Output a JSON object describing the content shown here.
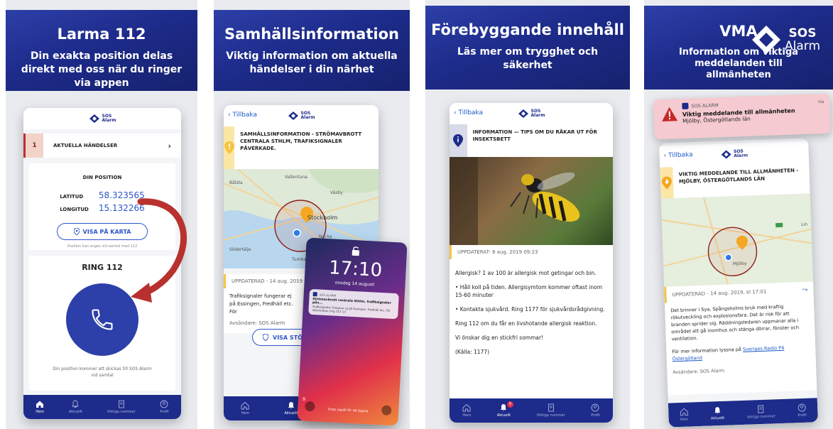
{
  "colors": {
    "navy": "#1d2b8a",
    "blue": "#2d3fa8",
    "red": "#b8312f",
    "yellow": "#f5c542",
    "link": "#1d59c8"
  },
  "nav": {
    "home": "Hem",
    "current": "Aktuellt",
    "numbers": "Viktiga nummer",
    "profile": "Profil",
    "badge": "9"
  },
  "logo": {
    "line1": "SOS",
    "line2": "Alarm"
  },
  "back_label": "Tillbaka",
  "panel1": {
    "title": "Larma 112",
    "subtitle": "Din exakta position delas direkt med oss när du ringer via appen",
    "events_count": "1",
    "events_label": "AKTUELLA HÄNDELSER",
    "position_heading": "DIN POSITION",
    "lat_label": "LATITUD",
    "lat_value": "58.323565",
    "lon_label": "LONGITUD",
    "lon_value": "15.132266",
    "map_button": "VISA PÅ KARTA",
    "position_note": "Position kan anges vid samtal med 112",
    "ring_heading": "RING 112",
    "ring_note": "Din position kommer att skickas till SOS Alarm vid samtal"
  },
  "panel2": {
    "title": "Samhällsinformation",
    "subtitle": "Viktig information om aktuella händelser i din närhet",
    "alert": "SAMHÄLLSINFORMATION - STRÖMAVBROTT CENTRALA STHLM, TRAFIKSIGNALER PÅVERKADE.",
    "map_labels": [
      "Vallentuna",
      "Bålsta",
      "Stockholm",
      "Nacka",
      "Södertälje",
      "Tumba",
      "Väsby"
    ],
    "updated": "UPPDATERAD - 14 aug. 2019",
    "body": "Trafiksignaler fungerar ej på Essingen, Fredhäll etc. För",
    "sender": "Avsändare: SOS Alarm",
    "map_button": "VISA STÖ",
    "lock_time": "17:10",
    "lock_date": "onsdag 14 augusti",
    "notif_app": "SOS ALARM",
    "notif_title": "Strömavbrott centrala Sthlm, trafiksignaler påv...",
    "notif_body": "Trafiksignaler fungerar ej på Essingen, Fredhäll etc. För information ring 113 13",
    "swipe": "Svep uppåt för att öppna"
  },
  "panel3": {
    "title": "Förebyggande innehåll",
    "subtitle": "Läs mer om trygghet och säkerhet",
    "alert": "INFORMATION — TIPS OM DU RÅKAR UT FÖR INSEKTSBETT",
    "updated": "UPPDATERAT- 8 aug. 2019 09:23",
    "paragraphs": [
      "Allergisk? 1 av 100 är allergisk mot getingar och bin.",
      "• Håll koll på tiden. Allergisymtom kommer oftast inom 15-60 minuter",
      "• Kontakta sjukvård. Ring 1177 för sjukvårdsrådgivning.",
      "Ring 112 om du får en livshotande allergisk reaktion.",
      "Vi önskar dig en stickfri sommar!",
      "(Källa: 1177)"
    ]
  },
  "panel4": {
    "title": "VMA",
    "subtitle": "Information om viktiga meddelanden till allmänheten",
    "notif_app": "SOS ALARM",
    "notif_time": "nu",
    "notif_title": "Viktig meddelande till allmänheten",
    "notif_body": "Mjölby, Östergötlands län",
    "alert": "VIKTIG MEDDELANDE TILL ALLMÄNHETEN - MJÖLBY, ÖSTERGÖTLANDS LÄN",
    "map_labels": [
      "Mjölby",
      "Lin"
    ],
    "updated": "UPPDATERAD - 14 aug. 2019, kl 17:01",
    "body": "Det brinner i Sya, Spångsholms bruk med kraftig rökutveckling och explosionsfara. Det är risk för att branden sprider sig. Räddningsledaren uppmanar alla i området att gå inomhus och stänga dörrar, fönster och ventilation.",
    "more_prefix": "För mer information lyssna på",
    "more_link": "Sveriges Radio P4 Östergötland",
    "sender": "Avsändare: SOS Alarm",
    "watermark_sos": "SOS",
    "watermark_alarm": "Alarm"
  }
}
